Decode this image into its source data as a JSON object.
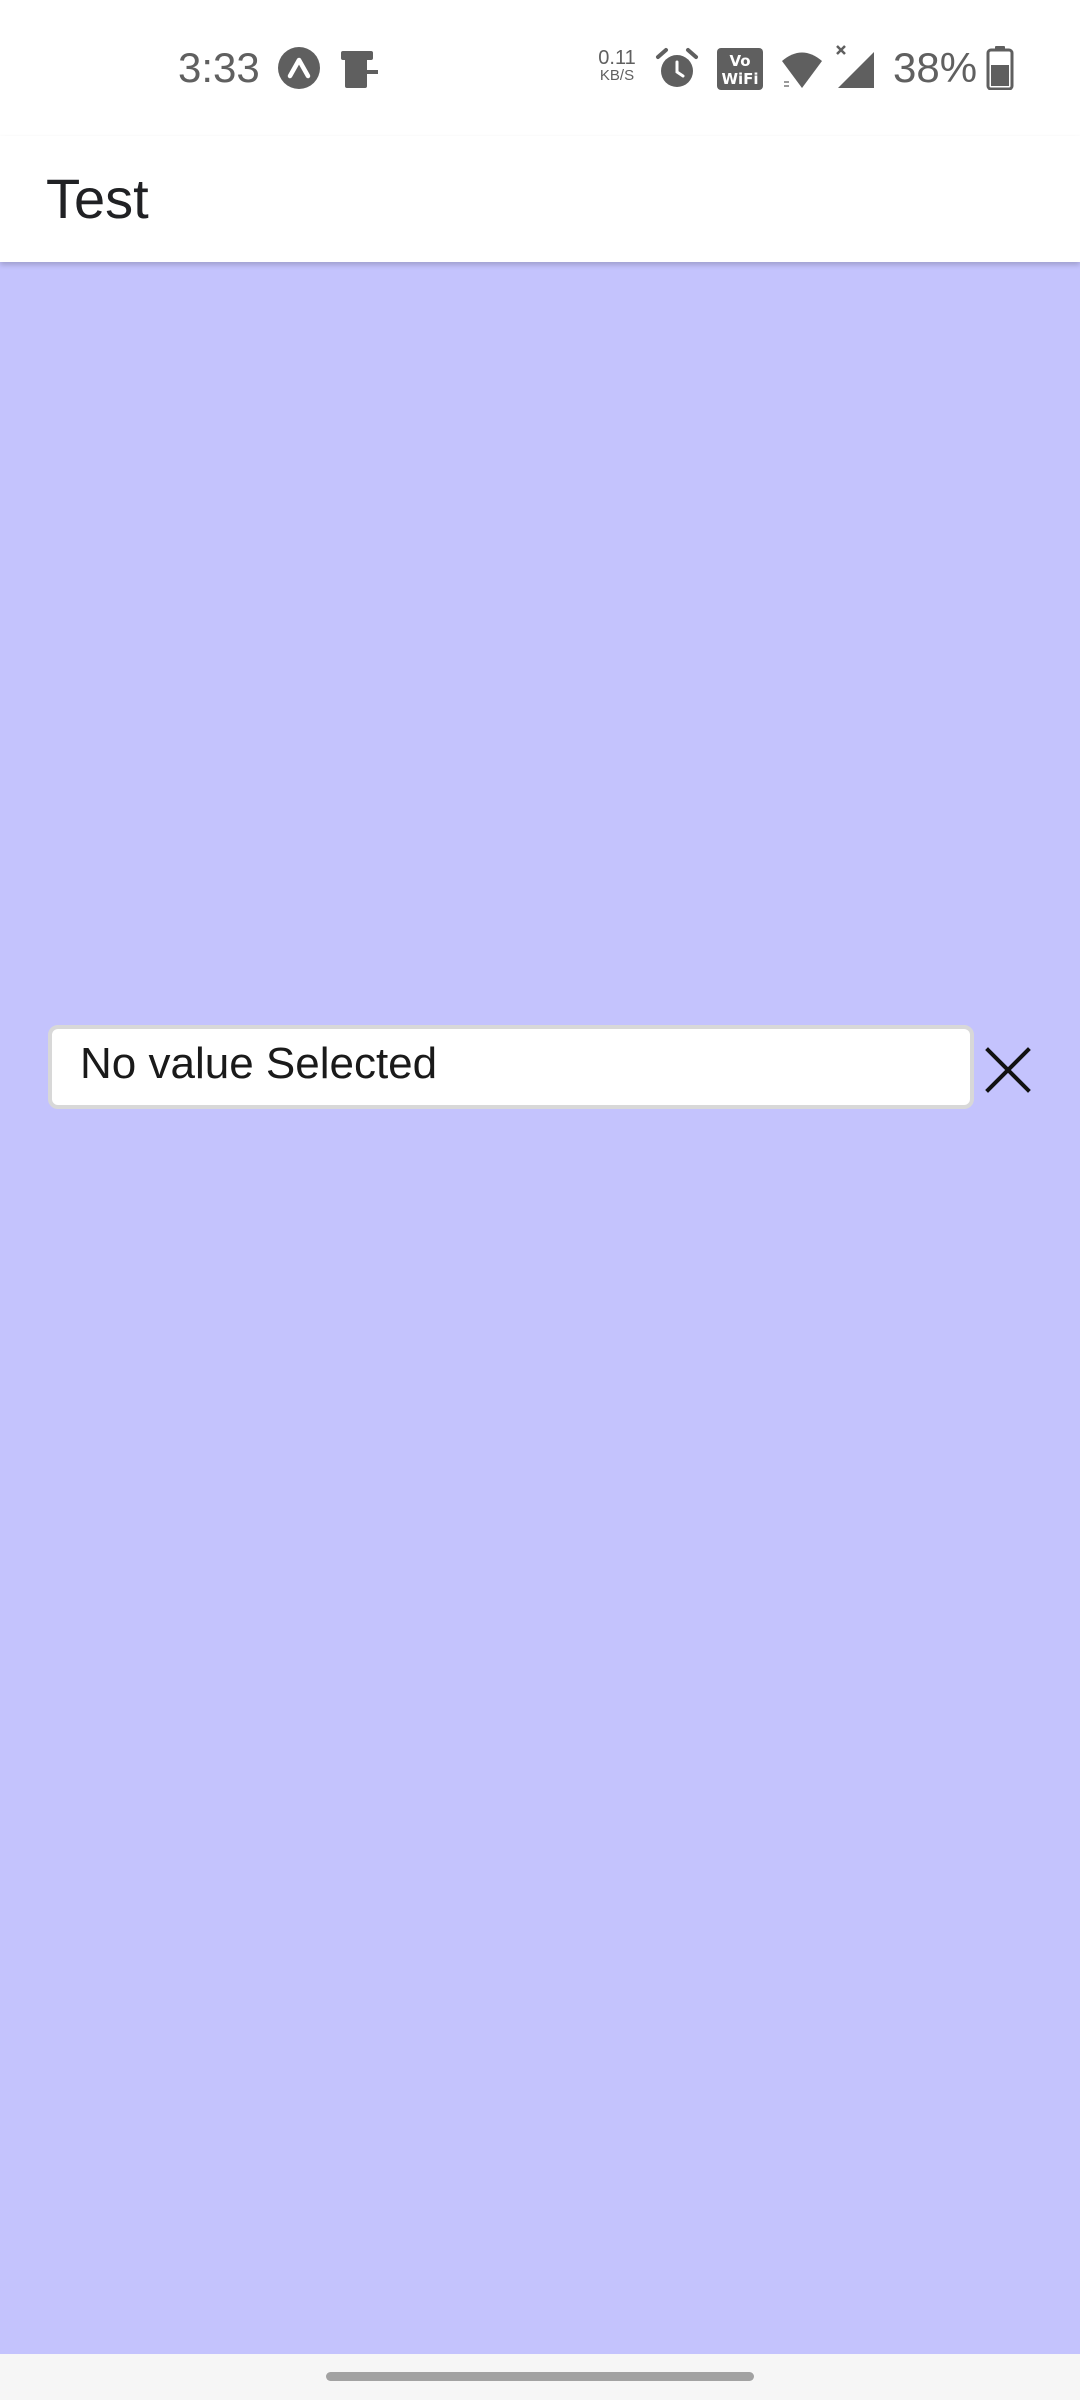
{
  "status_bar": {
    "time": "3:33",
    "net_speed_value": "0.11",
    "net_speed_unit": "KB/S",
    "battery_percent": "38%",
    "icons": [
      "expo-icon",
      "device-icon",
      "alarm-icon",
      "vowifi-icon",
      "wifi-icon",
      "signal-icon",
      "battery-icon"
    ],
    "vowifi_top": "Vo",
    "vowifi_bottom": "WiFi"
  },
  "app_bar": {
    "title": "Test"
  },
  "picker": {
    "value": "No value Selected",
    "clear_icon": "close-icon"
  },
  "colors": {
    "content_background": "#c4c3fd",
    "app_bar_background": "#ffffff",
    "field_border": "#d8d8d8"
  }
}
